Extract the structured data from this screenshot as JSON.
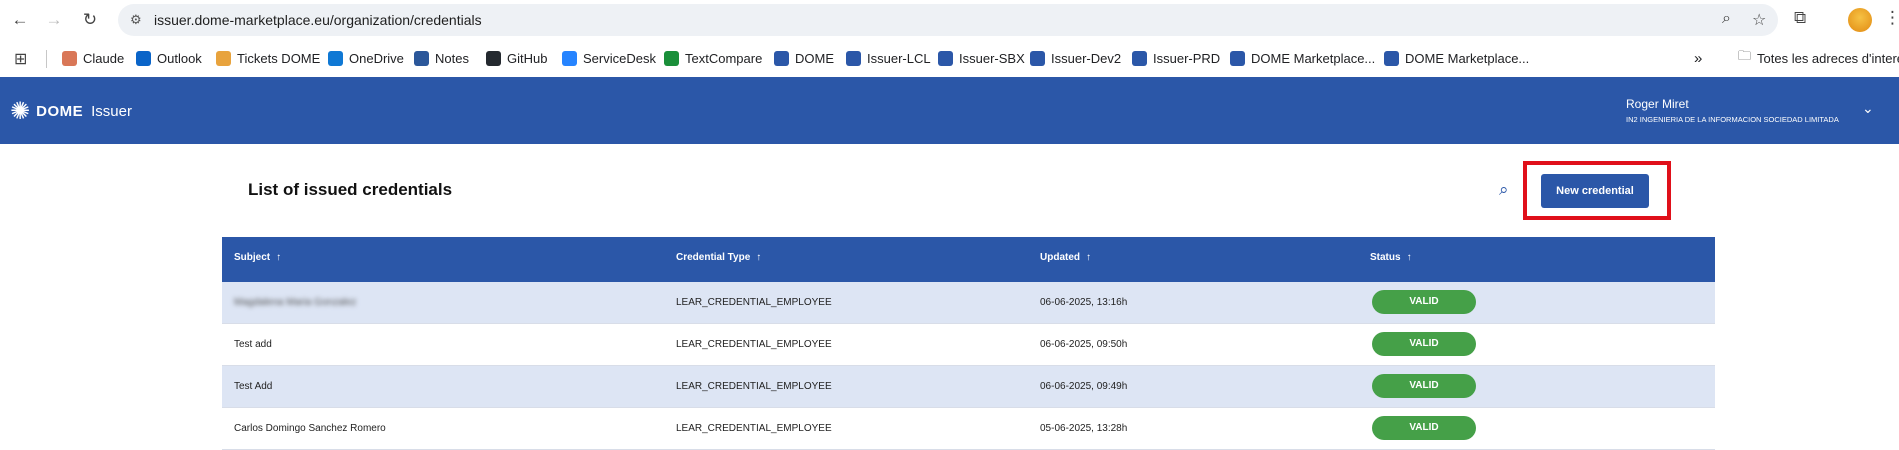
{
  "browser": {
    "url": "issuer.dome-marketplace.eu/organization/credentials",
    "bookmarks": [
      {
        "label": "Claude",
        "color": "#d97757"
      },
      {
        "label": "Outlook",
        "color": "#0a64c8"
      },
      {
        "label": "Tickets DOME",
        "color": "#e8a33d"
      },
      {
        "label": "OneDrive",
        "color": "#0f78d4"
      },
      {
        "label": "Notes",
        "color": "#2b579a"
      },
      {
        "label": "GitHub",
        "color": "#24292f"
      },
      {
        "label": "ServiceDesk",
        "color": "#2684ff"
      },
      {
        "label": "TextCompare",
        "color": "#1a8f3a"
      },
      {
        "label": "DOME",
        "color": "#2b57a8"
      },
      {
        "label": "Issuer-LCL",
        "color": "#2b57a8"
      },
      {
        "label": "Issuer-SBX",
        "color": "#2b57a8"
      },
      {
        "label": "Issuer-Dev2",
        "color": "#2b57a8"
      },
      {
        "label": "Issuer-PRD",
        "color": "#2b57a8"
      },
      {
        "label": "DOME Marketplace...",
        "color": "#2b57a8"
      },
      {
        "label": "DOME Marketplace...",
        "color": "#2b57a8"
      }
    ],
    "more_bookmarks": "»",
    "all_bookmarks": "Totes les adreces d'interès"
  },
  "header": {
    "logo_dome": "DOME",
    "logo_issuer": "Issuer",
    "user_name": "Roger Miret",
    "user_org": "IN2 INGENIERIA DE LA INFORMACION SOCIEDAD LIMITADA"
  },
  "main": {
    "title": "List of issued credentials",
    "new_button": "New credential",
    "columns": [
      "Subject",
      "Credential Type",
      "Updated",
      "Status"
    ],
    "sort_arrow": "↑",
    "rows": [
      {
        "subject": "Magdalena Maria Gonzalez",
        "type": "LEAR_CREDENTIAL_EMPLOYEE",
        "updated": "06-06-2025, 13:16h",
        "status": "VALID"
      },
      {
        "subject": "Test add",
        "type": "LEAR_CREDENTIAL_EMPLOYEE",
        "updated": "06-06-2025, 09:50h",
        "status": "VALID"
      },
      {
        "subject": "Test Add",
        "type": "LEAR_CREDENTIAL_EMPLOYEE",
        "updated": "06-06-2025, 09:49h",
        "status": "VALID"
      },
      {
        "subject": "Carlos Domingo Sanchez Romero",
        "type": "LEAR_CREDENTIAL_EMPLOYEE",
        "updated": "05-06-2025, 13:28h",
        "status": "VALID"
      }
    ]
  },
  "colors": {
    "brand": "#2b57a8",
    "valid": "#45a048",
    "highlight": "#e0101a",
    "row_alt": "#dde5f4"
  }
}
